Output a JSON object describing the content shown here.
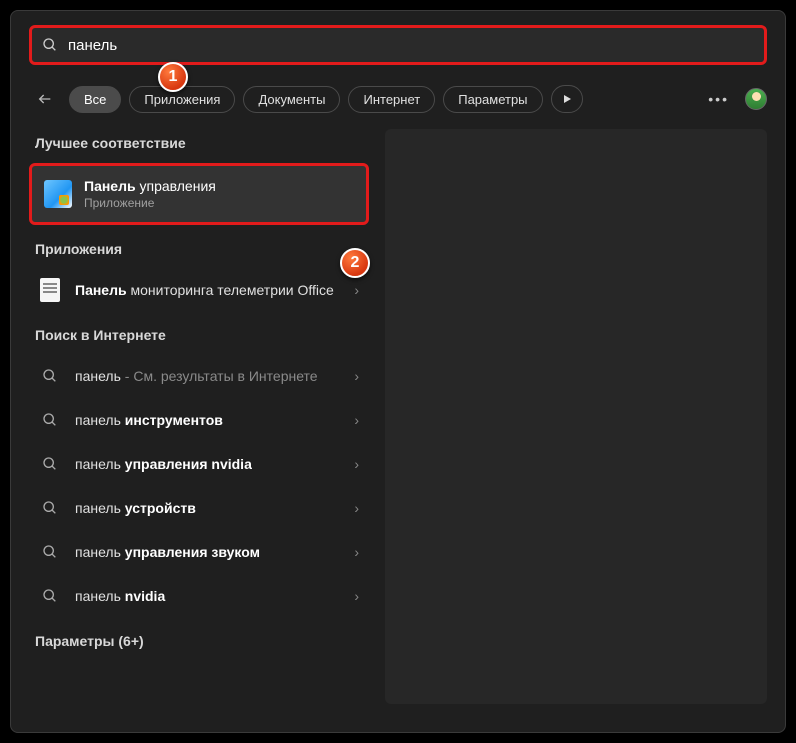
{
  "search": {
    "query": "панель"
  },
  "filters": {
    "all": "Все",
    "apps": "Приложения",
    "docs": "Документы",
    "web": "Интернет",
    "settings": "Параметры"
  },
  "sections": {
    "best": "Лучшее соответствие",
    "apps": "Приложения",
    "web": "Поиск в Интернете",
    "settings": "Параметры (6+)"
  },
  "best_match": {
    "title_bold": "Панель",
    "title_rest": " управления",
    "sub": "Приложение"
  },
  "app_item": {
    "bold": "Панель",
    "rest": " мониторинга телеметрии Office"
  },
  "web_items": [
    {
      "prefix": "панель",
      "suffix_muted": " - См. результаты в Интернете",
      "bold": ""
    },
    {
      "prefix": "панель ",
      "bold": "инструментов",
      "suffix_muted": ""
    },
    {
      "prefix": "панель ",
      "bold": "управления nvidia",
      "suffix_muted": ""
    },
    {
      "prefix": "панель ",
      "bold": "устройств",
      "suffix_muted": ""
    },
    {
      "prefix": "панель ",
      "bold": "управления звуком",
      "suffix_muted": ""
    },
    {
      "prefix": "панель ",
      "bold": "nvidia",
      "suffix_muted": ""
    }
  ],
  "annotations": {
    "one": "1",
    "two": "2"
  }
}
